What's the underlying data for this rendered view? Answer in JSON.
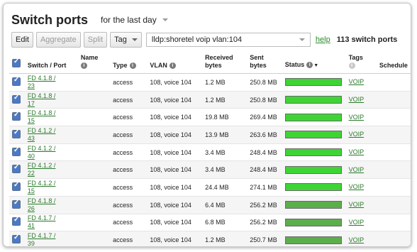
{
  "header": {
    "title": "Switch ports",
    "timespan": "for the last day"
  },
  "toolbar": {
    "edit": "Edit",
    "aggregate": "Aggregate",
    "split": "Split",
    "tag": "Tag",
    "search_value": "lldp:shoretel voip vlan:104",
    "help": "help",
    "count": "113 switch ports"
  },
  "columns": {
    "port": "Switch / Port",
    "name": "Name",
    "type": "Type",
    "vlan": "VLAN",
    "received": "Received bytes",
    "sent": "Sent bytes",
    "status": "Status",
    "tags": "Tags",
    "schedule": "Schedule"
  },
  "colors": {
    "status_bright": "#3fd435",
    "status_dim": "#5cae4b",
    "link": "#2a7a2a"
  },
  "rows": [
    {
      "port": "FD 4.1.8 / 23",
      "type": "access",
      "vlan": "108, voice 104",
      "received": "1.2 MB",
      "sent": "250.8 MB",
      "status_color": "#3fd435",
      "tag": "VOIP"
    },
    {
      "port": "FD 4.1.8 / 17",
      "type": "access",
      "vlan": "108, voice 104",
      "received": "1.2 MB",
      "sent": "250.8 MB",
      "status_color": "#3fd435",
      "tag": "VOIP"
    },
    {
      "port": "FD 4.1.8 / 15",
      "type": "access",
      "vlan": "108, voice 104",
      "received": "19.8 MB",
      "sent": "269.4 MB",
      "status_color": "#3fd435",
      "tag": "VOIP"
    },
    {
      "port": "FD 4.1.2 / 43",
      "type": "access",
      "vlan": "108, voice 104",
      "received": "13.9 MB",
      "sent": "263.6 MB",
      "status_color": "#3fd435",
      "tag": "VOIP"
    },
    {
      "port": "FD 4.1.2 / 40",
      "type": "access",
      "vlan": "108, voice 104",
      "received": "3.4 MB",
      "sent": "248.4 MB",
      "status_color": "#3fd435",
      "tag": "VOIP"
    },
    {
      "port": "FD 4.1.2 / 22",
      "type": "access",
      "vlan": "108, voice 104",
      "received": "3.4 MB",
      "sent": "248.4 MB",
      "status_color": "#3fd435",
      "tag": "VOIP"
    },
    {
      "port": "FD 4.1.2 / 15",
      "type": "access",
      "vlan": "108, voice 104",
      "received": "24.4 MB",
      "sent": "274.1 MB",
      "status_color": "#3fd435",
      "tag": "VOIP"
    },
    {
      "port": "FD 4.1.8 / 26",
      "type": "access",
      "vlan": "108, voice 104",
      "received": "6.4 MB",
      "sent": "256.2 MB",
      "status_color": "#5cae4b",
      "tag": "VOIP"
    },
    {
      "port": "FD 4.1.7 / 41",
      "type": "access",
      "vlan": "108, voice 104",
      "received": "6.8 MB",
      "sent": "256.2 MB",
      "status_color": "#5cae4b",
      "tag": "VOIP"
    },
    {
      "port": "FD 4.1.7 / 39",
      "type": "access",
      "vlan": "108, voice 104",
      "received": "1.2 MB",
      "sent": "250.7 MB",
      "status_color": "#5cae4b",
      "tag": "VOIP"
    }
  ]
}
